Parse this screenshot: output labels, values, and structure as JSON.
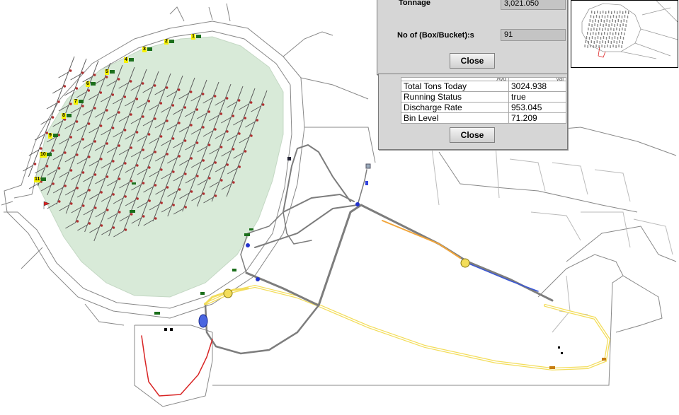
{
  "map": {
    "area_labels": [
      "1",
      "2",
      "3",
      "4",
      "5",
      "6",
      "7",
      "8",
      "9",
      "10",
      "11"
    ],
    "colors": {
      "extraction_area": "#d8ead8",
      "route_gray": "#7d7d7d",
      "route_orange": "#f2a53a",
      "route_yellow": "#f3dd5a",
      "route_red": "#d82424",
      "route_blue": "#3a57d6",
      "label_yellow": "#f6f200",
      "flag_green": "#1b6f1b"
    }
  },
  "tonnage_dialog": {
    "tonnage_label": "Tonnage",
    "tonnage_value": "3,021.050",
    "boxes_label": "No of (Box/Bucket):s",
    "boxes_value": "91",
    "close_label": "Close"
  },
  "status_dialog": {
    "header_left": "Avg",
    "header_right": "Val",
    "rows": [
      {
        "label": "Total Tons Today",
        "value": "3024.938"
      },
      {
        "label": "Running Status",
        "value": "true"
      },
      {
        "label": "Discharge Rate",
        "value": "953.045"
      },
      {
        "label": "Bin Level",
        "value": "71.209"
      }
    ],
    "close_label": "Close"
  },
  "overview_map": {}
}
